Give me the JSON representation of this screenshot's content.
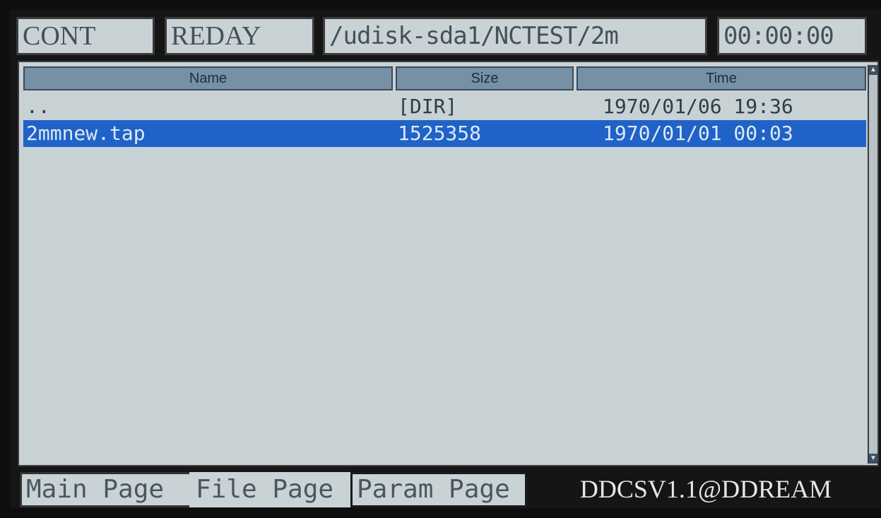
{
  "status": {
    "mode": "CONT",
    "state": "REDAY",
    "path": "/udisk-sda1/NCTEST/2m",
    "time": "00:00:00"
  },
  "file_list": {
    "columns": [
      "Name",
      "Size",
      "Time"
    ],
    "rows": [
      {
        "name": "..",
        "size": "[DIR]",
        "time": "1970/01/06 19:36",
        "selected": false
      },
      {
        "name": "2mmnew.tap",
        "size": "1525358",
        "time": "1970/01/01 00:03",
        "selected": true
      }
    ]
  },
  "tabs": {
    "main": "Main Page",
    "file": "File Page",
    "param": "Param Page"
  },
  "brand": "DDCSV1.1@DDREAM",
  "icons": {
    "scroll_up": "arrow-up-icon",
    "scroll_down": "arrow-down-icon"
  },
  "colors": {
    "selection": "#1f62c8",
    "header": "#7690a6",
    "panel": "#c8d1d4",
    "frame": "#151515"
  }
}
